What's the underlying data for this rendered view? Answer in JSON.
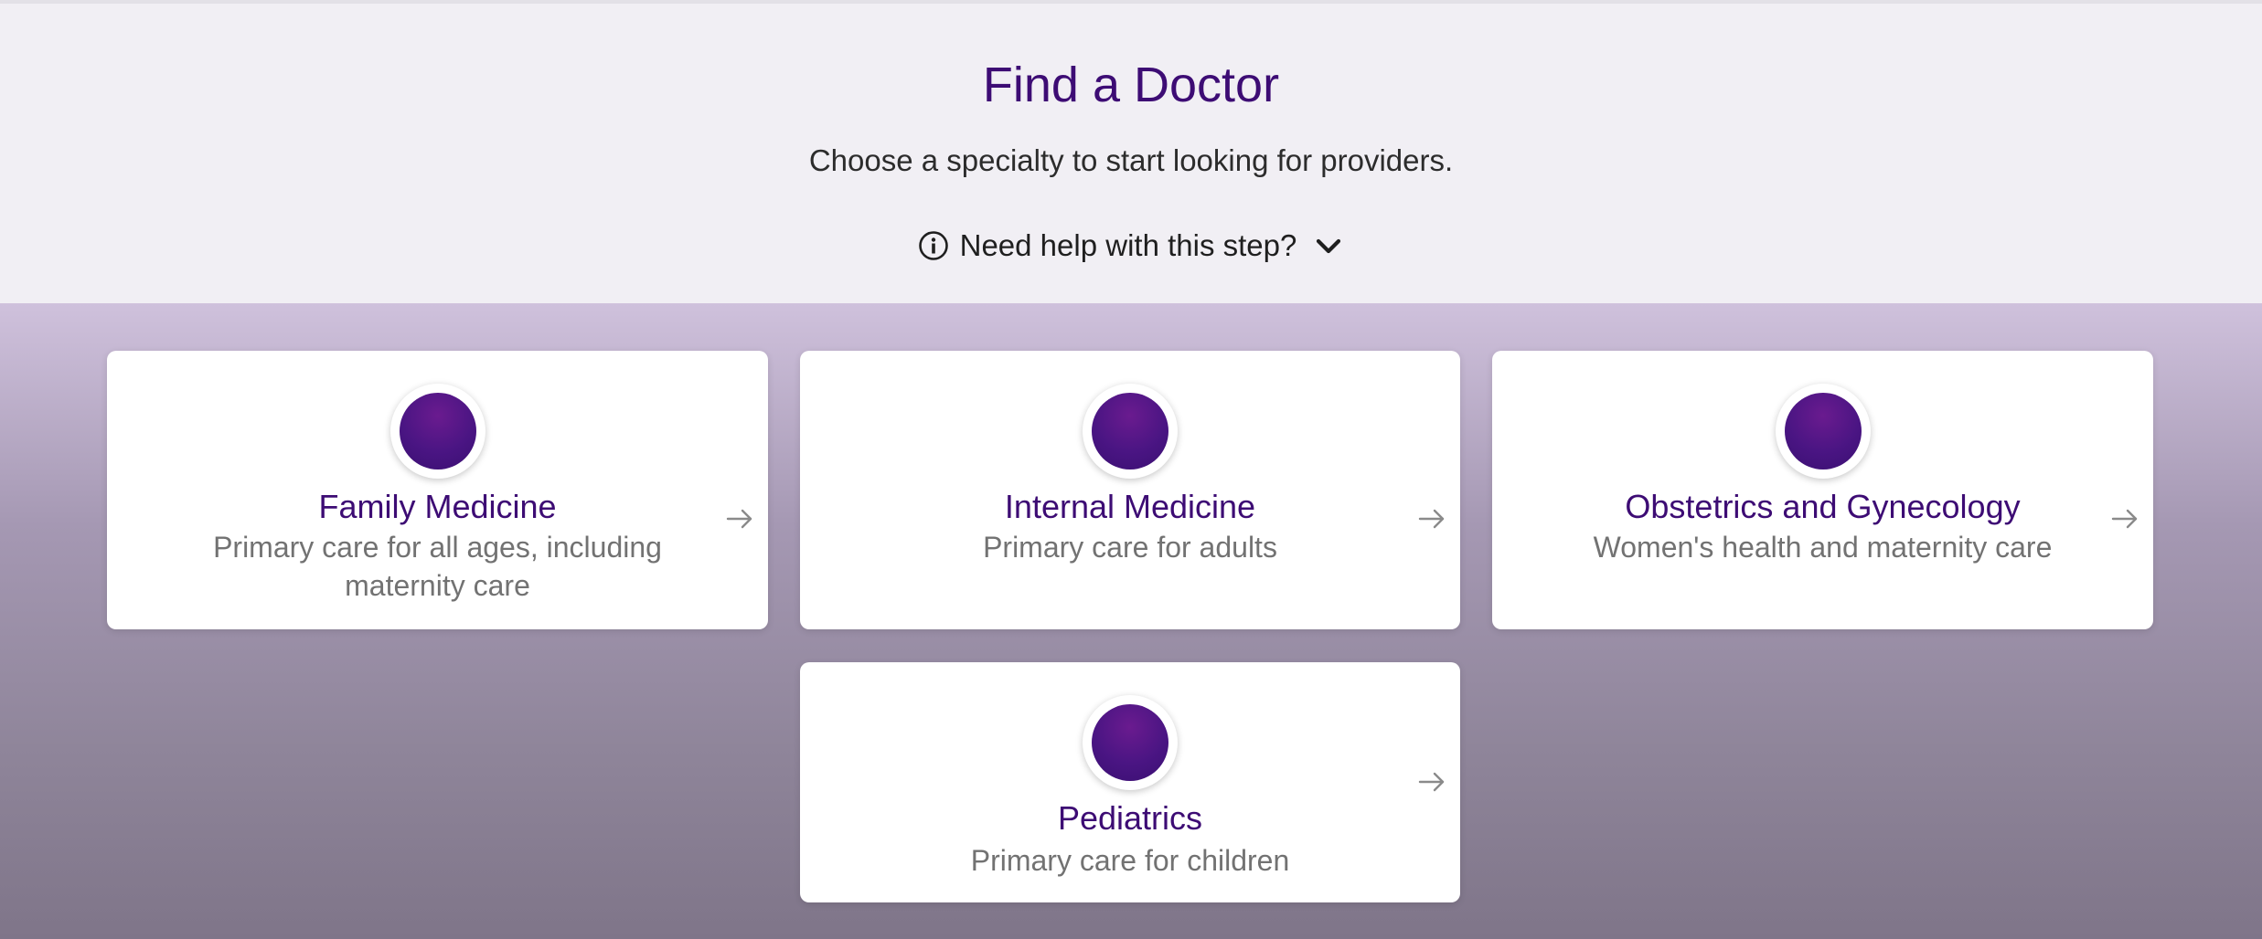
{
  "header": {
    "title": "Find a Doctor",
    "subtitle": "Choose a specialty to start looking for providers.",
    "help_label": "Need help with this step?"
  },
  "colors": {
    "brand": "#3d0c74",
    "background": "#f1eff4",
    "description_text": "#727272"
  },
  "specialties": [
    {
      "title": "Family Medicine",
      "description": "Primary care for all ages, including maternity care",
      "icon": "specialty-avatar"
    },
    {
      "title": "Internal Medicine",
      "description": "Primary care for adults",
      "icon": "specialty-avatar"
    },
    {
      "title": "Obstetrics and Gynecology",
      "description": "Women's health and maternity care",
      "icon": "specialty-avatar"
    },
    {
      "title": "Pediatrics",
      "description": "Primary care for children",
      "icon": "specialty-avatar"
    }
  ]
}
